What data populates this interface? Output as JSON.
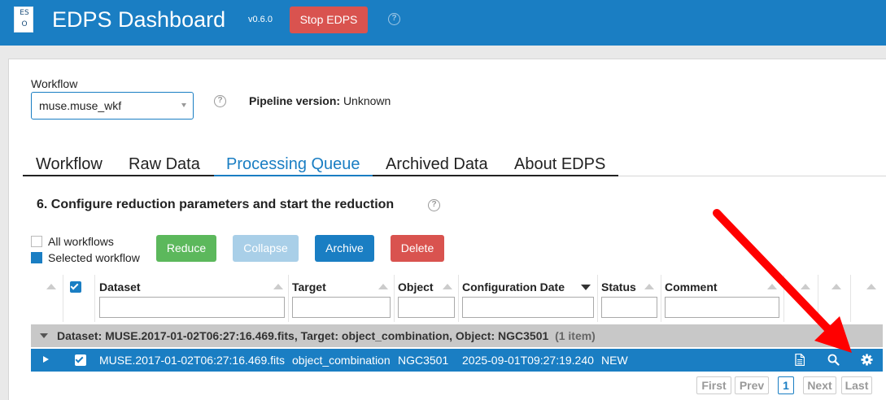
{
  "header": {
    "title": "EDPS Dashboard",
    "version": "v0.6.0",
    "stop_label": "Stop EDPS",
    "help_symbol": "?",
    "logo_top": "ES",
    "logo_bottom": "O"
  },
  "workflow": {
    "label": "Workflow",
    "selected": "muse.muse_wkf",
    "pipeline_label": "Pipeline version:",
    "pipeline_value": "Unknown"
  },
  "tabs": [
    {
      "label": "Workflow"
    },
    {
      "label": "Raw Data"
    },
    {
      "label": "Processing Queue"
    },
    {
      "label": "Archived Data"
    },
    {
      "label": "About EDPS"
    }
  ],
  "section": {
    "title": "6. Configure reduction parameters and start the reduction"
  },
  "scope": {
    "all_label": "All workflows",
    "selected_label": "Selected workflow"
  },
  "actions": {
    "reduce": "Reduce",
    "collapse": "Collapse",
    "archive": "Archive",
    "delete": "Delete"
  },
  "table": {
    "columns": [
      "Dataset",
      "Target",
      "Object",
      "Configuration Date",
      "Status",
      "Comment"
    ],
    "group_text": "Dataset: MUSE.2017-01-02T06:27:16.469.fits, Target: object_combination, Object: NGC3501",
    "group_count": "(1 item)",
    "rows": [
      {
        "dataset": "MUSE.2017-01-02T06:27:16.469.fits",
        "target": "object_combination",
        "object": "NGC3501",
        "config_date": "2025-09-01T09:27:19.240",
        "status": "NEW"
      }
    ]
  },
  "pagination": {
    "first": "First",
    "prev": "Prev",
    "current": "1",
    "next": "Next",
    "last": "Last"
  },
  "colors": {
    "brand": "#1a7ec3",
    "danger": "#d9534f",
    "success": "#5cb85c",
    "annotation": "#ff0000"
  },
  "icons": [
    "help-icon",
    "document-icon",
    "search-icon",
    "gear-icon",
    "expand-icon",
    "sort-icon"
  ]
}
